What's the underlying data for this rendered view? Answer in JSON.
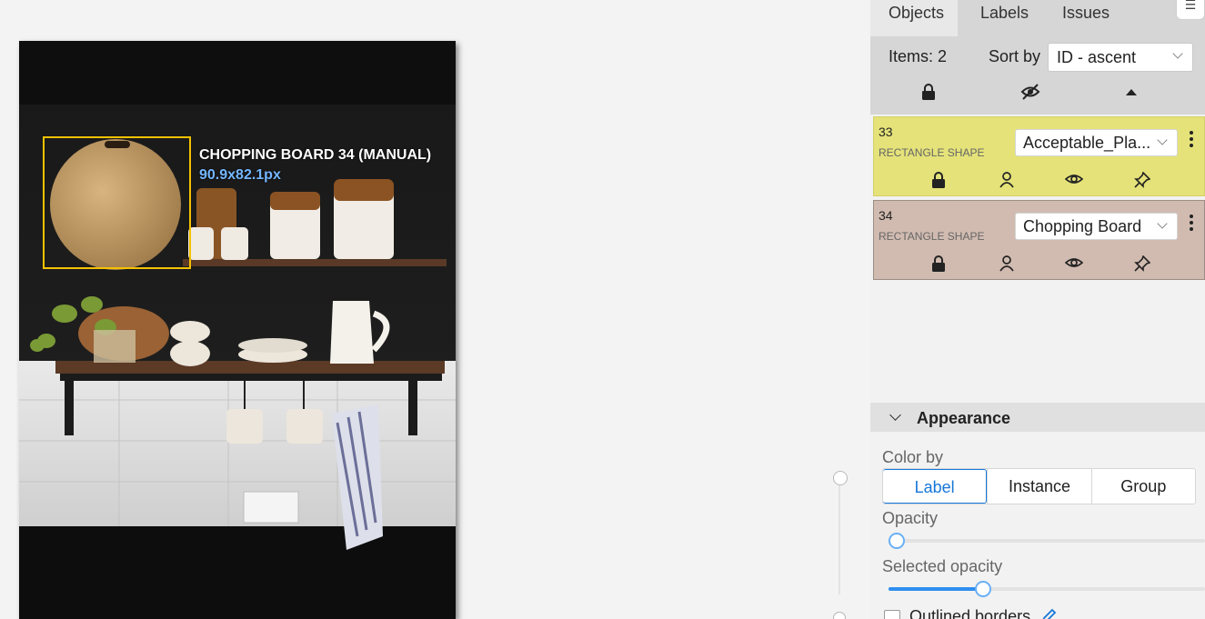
{
  "canvas": {
    "annotation": {
      "label": "CHOPPING BOARD 34 (MANUAL)",
      "size": "90.9x82.1px"
    }
  },
  "panel": {
    "tabs": [
      "Objects",
      "Labels",
      "Issues"
    ],
    "active_tab": "Objects",
    "items_label": "Items: 2",
    "sort_by_label": "Sort by",
    "sort_value": "ID - ascent",
    "header_icons": [
      "lock-icon",
      "eye-off-icon",
      "caret-up-icon"
    ],
    "objects": [
      {
        "id": "33",
        "type": "RECTANGLE SHAPE",
        "label": "Acceptable_Pla...",
        "color": "#e4e279"
      },
      {
        "id": "34",
        "type": "RECTANGLE SHAPE",
        "label": "Chopping Board",
        "color": "#d1bbb0"
      }
    ],
    "object_icons": [
      "lock-icon",
      "user-icon",
      "eye-icon",
      "pin-icon"
    ]
  },
  "appearance": {
    "title": "Appearance",
    "color_by_label": "Color by",
    "color_by_options": [
      "Label",
      "Instance",
      "Group"
    ],
    "color_by_selected": "Label",
    "opacity_label": "Opacity",
    "opacity_value": 0.0,
    "selected_opacity_label": "Selected opacity",
    "selected_opacity_value": 0.3,
    "outlined_borders_label": "Outlined borders",
    "accent_color": "#1677d8"
  }
}
